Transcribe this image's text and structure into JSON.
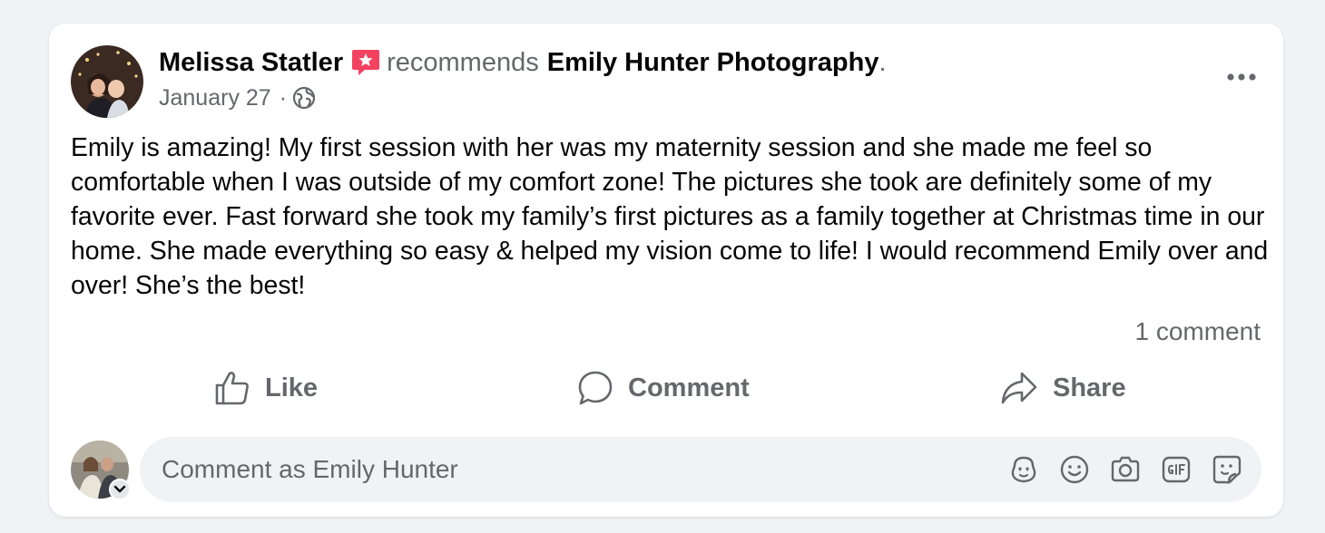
{
  "post": {
    "author": "Melissa Statler",
    "action_word": "recommends",
    "page_name": "Emily Hunter Photography",
    "period": ".",
    "date": "January 27",
    "separator": "·",
    "privacy_icon": "globe-icon",
    "body": "Emily is amazing! My first session with her was my maternity session and she made me feel so comfortable when I was outside of my comfort zone! The pictures she took are definitely some of my favorite ever. Fast forward she took my family’s first pictures as a family together at Christmas time in our home. She made everything so easy & helped my vision come to life! I would recommend Emily over and over! She’s the best!",
    "comment_count": "1 comment"
  },
  "actions": {
    "like_label": "Like",
    "comment_label": "Comment",
    "share_label": "Share"
  },
  "composer": {
    "placeholder": "Comment as Emily Hunter",
    "icons": [
      "avatar-sticker-icon",
      "emoji-icon",
      "camera-icon",
      "gif-icon",
      "sticker-icon"
    ]
  },
  "colors": {
    "page_bg": "#f0f2f5",
    "card_bg": "#ffffff",
    "secondary_text": "#65676b",
    "primary_text": "#050505",
    "recommend_badge": "#f3425f"
  }
}
